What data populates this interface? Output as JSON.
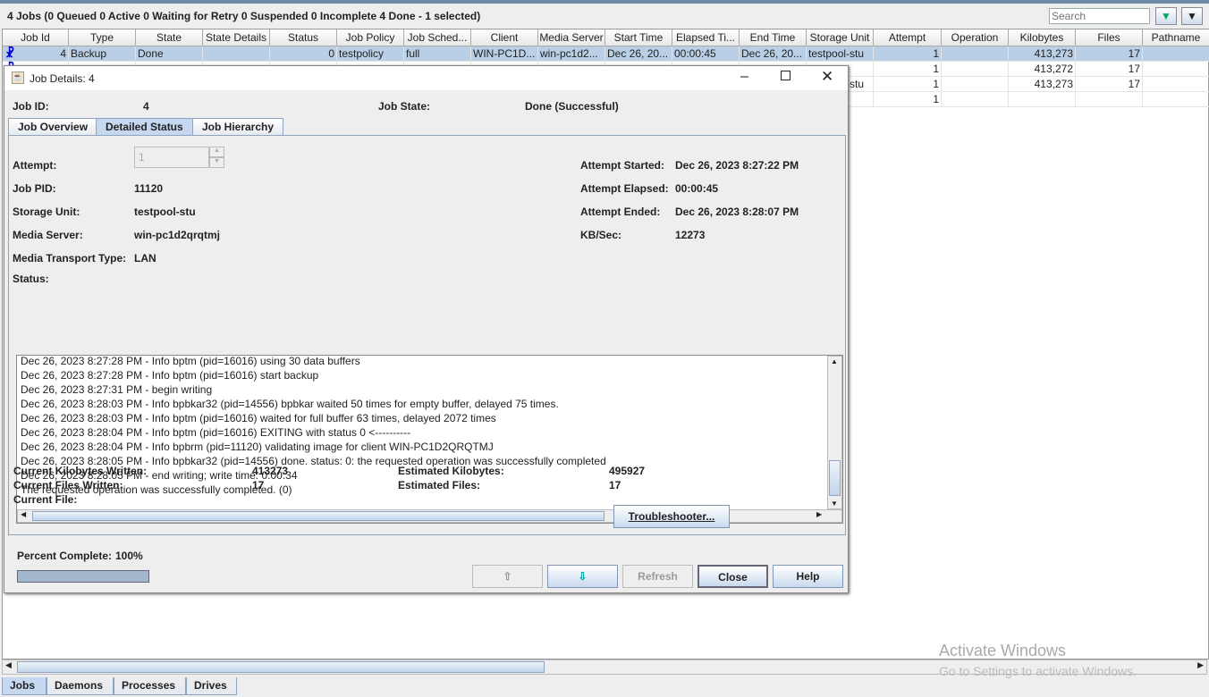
{
  "summary": "4 Jobs (0 Queued 0 Active 0 Waiting for Retry 0 Suspended 0 Incomplete 4 Done - 1 selected)",
  "search": {
    "placeholder": "Search"
  },
  "toolbar": {
    "filter_icon": "filter-icon",
    "menu_icon": "dropdown-icon"
  },
  "table": {
    "columns": [
      "Job Id",
      "Type",
      "State",
      "State Details",
      "Status",
      "Job Policy",
      "Job Sched...",
      "Client",
      "Media Server",
      "Start Time",
      "Elapsed Ti...",
      "End Time",
      "Storage Unit",
      "Attempt",
      "Operation",
      "Kilobytes",
      "Files",
      "Pathname"
    ],
    "rows": [
      [
        "4",
        "Backup",
        "Done",
        "",
        "0",
        "testpolicy",
        "full",
        "WIN-PC1D...",
        "win-pc1d2...",
        "Dec 26, 20...",
        "00:00:45",
        "Dec 26, 20...",
        "testpool-stu",
        "1",
        "",
        "413,273",
        "17",
        ""
      ],
      [
        "",
        "",
        "",
        "",
        "",
        "",
        "",
        "",
        "",
        "",
        "",
        "",
        "",
        "1",
        "",
        "413,272",
        "17",
        ""
      ],
      [
        "",
        "",
        "",
        "",
        "",
        "",
        "",
        "",
        "",
        "",
        "",
        "",
        "testpool-stu",
        "1",
        "",
        "413,273",
        "17",
        ""
      ],
      [
        "",
        "",
        "",
        "",
        "",
        "",
        "",
        "",
        "",
        "",
        "",
        "",
        "",
        "1",
        "",
        "",
        "",
        ""
      ]
    ]
  },
  "dialog": {
    "title": "Job Details: 4",
    "job_id_label": "Job ID:",
    "job_id": "4",
    "job_state_label": "Job State:",
    "job_state": "Done (Successful)",
    "tabs": [
      "Job Overview",
      "Detailed Status",
      "Job Hierarchy"
    ],
    "attempt_label": "Attempt:",
    "attempt": "1",
    "pid_label": "Job PID:",
    "pid": "11120",
    "stu_label": "Storage Unit:",
    "stu": "testpool-stu",
    "ms_label": "Media Server:",
    "ms": "win-pc1d2qrqtmj",
    "mtt_label": "Media Transport Type:",
    "mtt": "LAN",
    "started_label": "Attempt Started:",
    "started": "Dec 26, 2023 8:27:22 PM",
    "elapsed_label": "Attempt Elapsed:",
    "elapsed": "00:00:45",
    "ended_label": "Attempt Ended:",
    "ended": "Dec 26, 2023 8:28:07 PM",
    "kbs_label": "KB/Sec:",
    "kbs": "12273",
    "status_label": "Status:",
    "log": [
      "Dec 26, 2023 8:27:28 PM - Info bptm (pid=16016) using 30 data buffers",
      "Dec 26, 2023 8:27:28 PM - Info bptm (pid=16016) start backup",
      "Dec 26, 2023 8:27:31 PM - begin writing",
      "Dec 26, 2023 8:28:03 PM - Info bpbkar32 (pid=14556) bpbkar waited 50 times for empty buffer, delayed 75 times.",
      "Dec 26, 2023 8:28:03 PM - Info bptm (pid=16016) waited for full buffer 63 times, delayed 2072 times",
      "Dec 26, 2023 8:28:04 PM - Info bptm (pid=16016) EXITING with status 0 <----------",
      "Dec 26, 2023 8:28:04 PM - Info bpbrm (pid=11120) validating image for client WIN-PC1D2QRQTMJ",
      "Dec 26, 2023 8:28:05 PM - Info bpbkar32 (pid=14556) done. status: 0: the requested operation was successfully completed",
      "Dec 26, 2023 8:28:05 PM - end writing; write time: 0:00:34",
      "The requested operation was successfully completed.  (0)"
    ],
    "ckw_label": "Current Kilobytes Written:",
    "ckw": "413273",
    "cfw_label": "Current Files Written:",
    "cfw": "17",
    "cf_label": "Current File:",
    "ek_label": "Estimated Kilobytes:",
    "ek": "495927",
    "ef_label": "Estimated Files:",
    "ef": "17",
    "troubleshooter": "Troubleshooter...",
    "percent_label": "Percent Complete:",
    "percent": "100%",
    "progress": 100,
    "refresh": "Refresh",
    "close": "Close",
    "help": "Help"
  },
  "bottom_tabs": [
    "Jobs",
    "Daemons",
    "Processes",
    "Drives"
  ],
  "watermark": {
    "line1": "Activate Windows",
    "line2": "Go to Settings to activate Windows."
  }
}
